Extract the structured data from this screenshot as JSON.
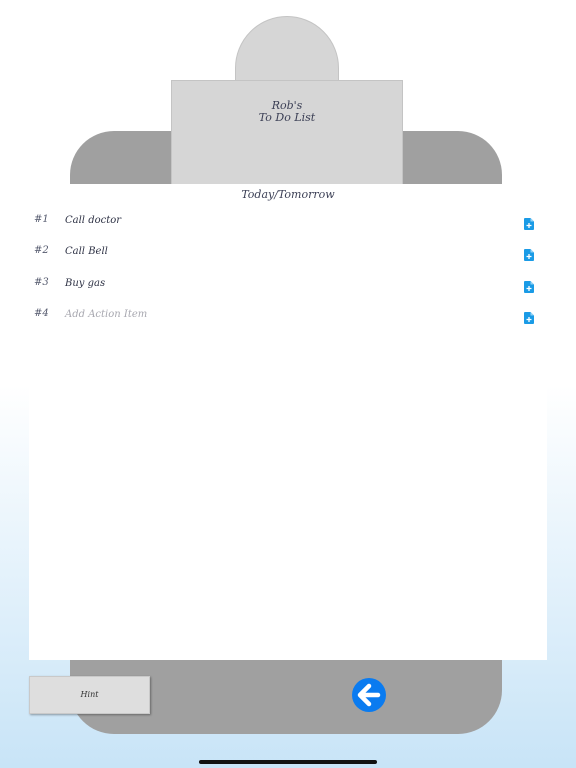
{
  "clipboard": {
    "title_line1": "Rob's",
    "title_line2": "To Do List"
  },
  "section": {
    "heading": "Today/Tomorrow"
  },
  "items": [
    {
      "number": "#1",
      "text": "Call doctor",
      "icon": "add-document-icon"
    },
    {
      "number": "#2",
      "text": "Call Bell",
      "icon": "add-document-icon"
    },
    {
      "number": "#3",
      "text": "Buy gas",
      "icon": "add-document-icon"
    }
  ],
  "new_item": {
    "number": "#4",
    "placeholder": "Add Action Item",
    "icon": "add-document-icon"
  },
  "footer": {
    "hint_label": "Hint",
    "back_icon": "arrow-left-icon"
  },
  "colors": {
    "accent": "#0a7bf0",
    "board": "#a0a0a0",
    "clip": "#d6d6d6"
  }
}
